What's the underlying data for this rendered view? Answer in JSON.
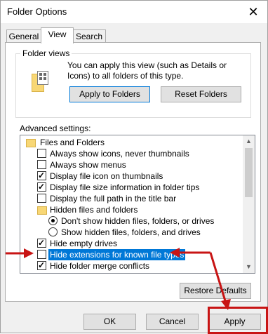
{
  "window": {
    "title": "Folder Options"
  },
  "tabs": [
    {
      "label": "General"
    },
    {
      "label": "View"
    },
    {
      "label": "Search"
    }
  ],
  "folder_views": {
    "legend": "Folder views",
    "description": "You can apply this view (such as Details or Icons) to all folders of this type.",
    "apply_button": "Apply to Folders",
    "reset_button": "Reset Folders"
  },
  "advanced": {
    "label": "Advanced settings:",
    "items": [
      {
        "type": "folder",
        "label": "Files and Folders"
      },
      {
        "type": "checkbox",
        "checked": false,
        "label": "Always show icons, never thumbnails"
      },
      {
        "type": "checkbox",
        "checked": false,
        "label": "Always show menus"
      },
      {
        "type": "checkbox",
        "checked": true,
        "label": "Display file icon on thumbnails"
      },
      {
        "type": "checkbox",
        "checked": true,
        "label": "Display file size information in folder tips"
      },
      {
        "type": "checkbox",
        "checked": false,
        "label": "Display the full path in the title bar"
      },
      {
        "type": "folder",
        "label": "Hidden files and folders"
      },
      {
        "type": "radio",
        "checked": true,
        "label": "Don't show hidden files, folders, or drives"
      },
      {
        "type": "radio",
        "checked": false,
        "label": "Show hidden files, folders, and drives"
      },
      {
        "type": "checkbox",
        "checked": true,
        "label": "Hide empty drives"
      },
      {
        "type": "checkbox",
        "checked": false,
        "label": "Hide extensions for known file types",
        "selected": true
      },
      {
        "type": "checkbox",
        "checked": true,
        "label": "Hide folder merge conflicts"
      }
    ],
    "restore_button": "Restore Defaults"
  },
  "footer": {
    "ok": "OK",
    "cancel": "Cancel",
    "apply": "Apply"
  },
  "colors": {
    "highlight": "#0078d7",
    "annotation": "#c81414"
  }
}
